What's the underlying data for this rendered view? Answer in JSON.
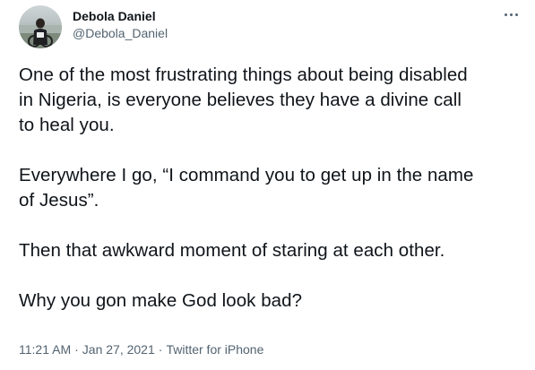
{
  "author": {
    "display_name": "Debola Daniel",
    "handle": "@Debola_Daniel",
    "avatar": "profile-photo"
  },
  "actions": {
    "more_icon": "more-horizontal-icon"
  },
  "tweet": {
    "paragraphs": [
      "One of the most frustrating things about being disabled\nin Nigeria, is everyone believes they have a divine call\nto heal you.",
      "Everywhere I go, “I command you to get up in the name\nof Jesus”.",
      "Then that awkward moment of staring at each other.",
      "Why you gon make God look bad?"
    ]
  },
  "meta": {
    "time": "11:21 AM",
    "separator_1": "·",
    "date": "Jan 27, 2021",
    "separator_2": "·",
    "source": "Twitter for iPhone"
  }
}
